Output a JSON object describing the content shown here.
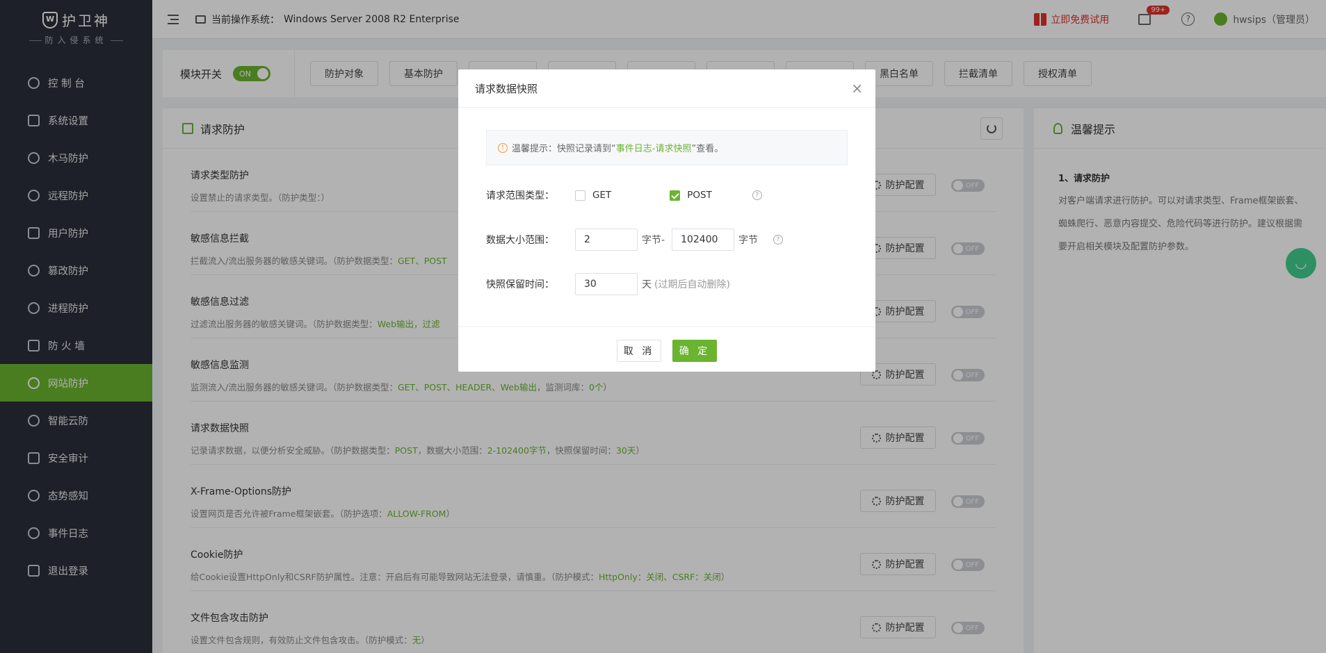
{
  "app": {
    "logo_main": "护卫神",
    "logo_sub": "防入侵系统"
  },
  "sidebar": {
    "items": [
      {
        "label": "控 制 台",
        "icon": "dashboard-icon"
      },
      {
        "label": "系统设置",
        "icon": "gear-icon"
      },
      {
        "label": "木马防护",
        "icon": "shield-icon"
      },
      {
        "label": "远程防护",
        "icon": "monitor-icon"
      },
      {
        "label": "用户防护",
        "icon": "users-icon"
      },
      {
        "label": "篡改防护",
        "icon": "lock-icon"
      },
      {
        "label": "进程防护",
        "icon": "process-icon"
      },
      {
        "label": "防 火 墙",
        "icon": "firewall-icon"
      },
      {
        "label": "网站防护",
        "icon": "globe-icon",
        "active": true
      },
      {
        "label": "智能云防",
        "icon": "cloud-icon"
      },
      {
        "label": "安全审计",
        "icon": "audit-icon"
      },
      {
        "label": "态势感知",
        "icon": "radar-icon"
      },
      {
        "label": "事件日志",
        "icon": "log-icon"
      },
      {
        "label": "退出登录",
        "icon": "logout-icon"
      }
    ]
  },
  "topbar": {
    "os_label": "当前操作系统：",
    "os_value": "Windows Server 2008 R2 Enterprise",
    "trial": "立即免费试用",
    "msg_badge": "99+",
    "help": "?",
    "user": "hwsips（管理员）"
  },
  "module": {
    "label": "模块开关",
    "switch": "ON",
    "tabs": [
      "防护对象",
      "基本防护",
      "",
      "",
      "",
      "",
      "",
      "黑白名单",
      "拦截清单",
      "授权清单"
    ]
  },
  "panel": {
    "title": "请求防护",
    "config_label": "防护配置",
    "switch_off": "OFF",
    "rows": [
      {
        "title": "请求类型防护",
        "desc": "设置禁止的请求类型。（防护类型：）",
        "hl": ""
      },
      {
        "title": "敏感信息拦截",
        "desc": "拦截流入/流出服务器的敏感关键词。（防护数据类型：",
        "hl": "GET、POST"
      },
      {
        "title": "敏感信息过滤",
        "desc": "过滤流出服务器的敏感关键词。（防护数据类型：",
        "hl": "Web输出，过滤"
      },
      {
        "title": "敏感信息监测",
        "desc": "监测流入/流出服务器的敏感关键词。（防护数据类型：",
        "hl": "GET、POST、HEADER、Web输出",
        "desc2": "，监测词库：",
        "hl2": "0个",
        "tail": "）"
      },
      {
        "title": "请求数据快照",
        "desc": "记录请求数据，以便分析安全威胁。（防护数据类型：",
        "hl": "POST",
        "desc2": "，数据大小范围：",
        "hl2": "2-102400字节",
        "desc3": "，快照保留时间：",
        "hl3": "30天",
        "tail": "）"
      },
      {
        "title": "X-Frame-Options防护",
        "desc": "设置网页是否允许被Frame框架嵌套。（防护选项：",
        "hl": "ALLOW-FROM",
        "tail": "）"
      },
      {
        "title": "Cookie防护",
        "desc": "给Cookie设置HttpOnly和CSRF防护属性。注意：开启后有可能导致网站无法登录，请慎重。（防护模式：",
        "hl": "HttpOnly：关闭、CSRF：关闭",
        "tail": "）"
      },
      {
        "title": "文件包含攻击防护",
        "desc": "设置文件包含规则，有效防止文件包含攻击。（防护模式：",
        "hl": "无",
        "tail": "）"
      }
    ]
  },
  "tips": {
    "title": "温馨提示",
    "subtitle": "1、请求防护",
    "text": "对客户端请求进行防护。可以对请求类型、Frame框架嵌套、蜘蛛爬行、恶意内容提交、危险代码等进行防护。建议根据需要开启相关模块及配置防护参数。"
  },
  "modal": {
    "title": "请求数据快照",
    "close": "×",
    "notice_prefix": "温馨提示：快照记录请到“",
    "notice_link": "事件日志-请求快照",
    "notice_suffix": "”查看。",
    "type_label": "请求范围类型：",
    "get_label": "GET",
    "get_checked": false,
    "post_label": "POST",
    "post_checked": true,
    "size_label": "数据大小范围：",
    "size_min": "2",
    "size_unit_mid": "字节-",
    "size_max": "102400",
    "size_unit": "字节",
    "keep_label": "快照保留时间：",
    "keep_value": "30",
    "keep_unit": "天",
    "keep_hint": "(过期后自动删除)",
    "cancel": "取 消",
    "ok": "确 定"
  },
  "colors": {
    "accent": "#6ab42f",
    "sidebar_bg": "#2a2f3a",
    "danger": "#e0332a"
  }
}
